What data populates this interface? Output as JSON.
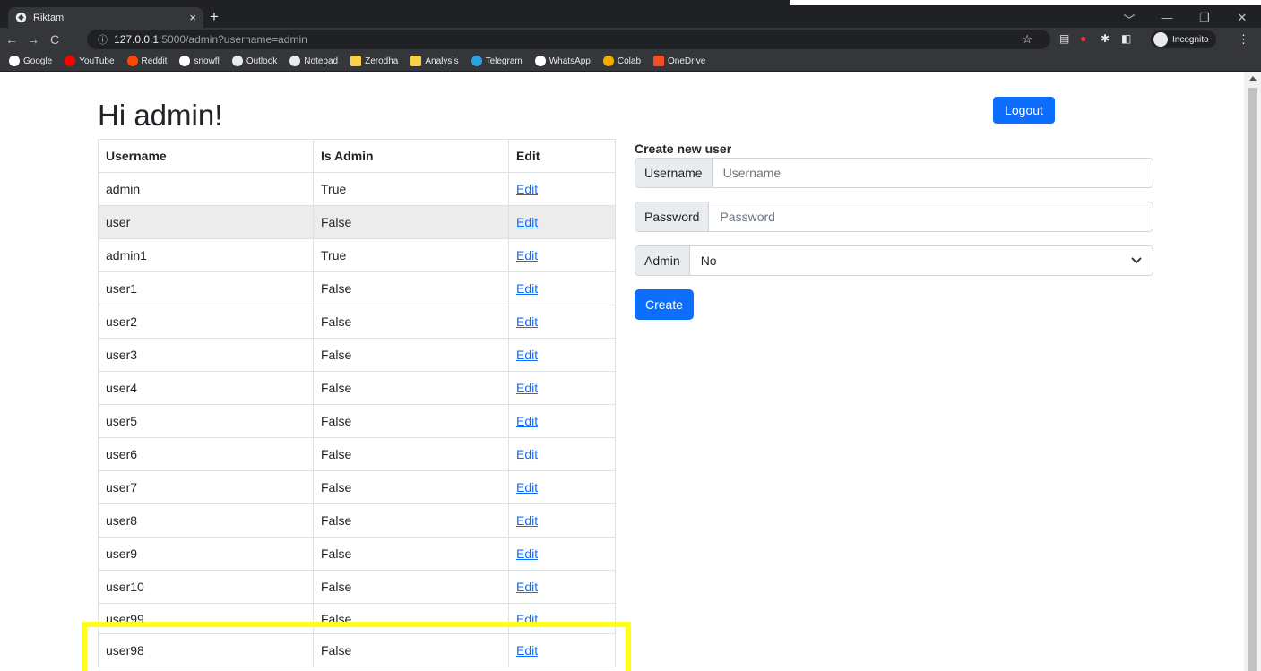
{
  "browser": {
    "tab_title": "Riktam",
    "tab_close": "×",
    "new_tab": "+",
    "url_info_icon": "ⓘ",
    "url_host": "127.0.0.1",
    "url_path": ":5000/admin?username=admin",
    "incognito_label": "Incognito",
    "window_controls": [
      "﹀",
      "—",
      "❐",
      "✕"
    ],
    "nav": [
      "←",
      "→",
      "C"
    ]
  },
  "bookmarks": [
    {
      "label": "Google",
      "color": "#ffffff"
    },
    {
      "label": "YouTube",
      "color": "#ff0000"
    },
    {
      "label": "Reddit",
      "color": "#ff4500"
    },
    {
      "label": "snowfl",
      "color": "#ffffff"
    },
    {
      "label": "Outlook",
      "color": "#e8eaed"
    },
    {
      "label": "Notepad",
      "color": "#e8eaed"
    },
    {
      "label": "Zerodha",
      "color": "#f9cf48"
    },
    {
      "label": "Analysis",
      "color": "#f9cf48"
    },
    {
      "label": "Telegram",
      "color": "#2aa3e0"
    },
    {
      "label": "WhatsApp",
      "color": "#ffffff"
    },
    {
      "label": "Colab",
      "color": "#f9ab00"
    },
    {
      "label": "OneDrive",
      "color": "#f25022"
    }
  ],
  "page": {
    "heading": "Hi admin!",
    "logout_label": "Logout",
    "table": {
      "headers": [
        "Username",
        "Is Admin",
        "Edit"
      ],
      "rows": [
        [
          "admin",
          "True",
          "Edit"
        ],
        [
          "user",
          "False",
          "Edit"
        ],
        [
          "admin1",
          "True",
          "Edit"
        ],
        [
          "user1",
          "False",
          "Edit"
        ],
        [
          "user2",
          "False",
          "Edit"
        ],
        [
          "user3",
          "False",
          "Edit"
        ],
        [
          "user4",
          "False",
          "Edit"
        ],
        [
          "user5",
          "False",
          "Edit"
        ],
        [
          "user6",
          "False",
          "Edit"
        ],
        [
          "user7",
          "False",
          "Edit"
        ],
        [
          "user8",
          "False",
          "Edit"
        ],
        [
          "user9",
          "False",
          "Edit"
        ],
        [
          "user10",
          "False",
          "Edit"
        ],
        [
          "user99",
          "False",
          "Edit"
        ],
        [
          "user98",
          "False",
          "Edit"
        ]
      ]
    },
    "form": {
      "title": "Create new user",
      "username_label": "Username",
      "username_placeholder": "Username",
      "password_label": "Password",
      "password_placeholder": "Password",
      "admin_label": "Admin",
      "admin_value": "No",
      "create_label": "Create"
    }
  },
  "colors": {
    "primary": "#0d6efd",
    "highlight": "#ffff1a"
  }
}
